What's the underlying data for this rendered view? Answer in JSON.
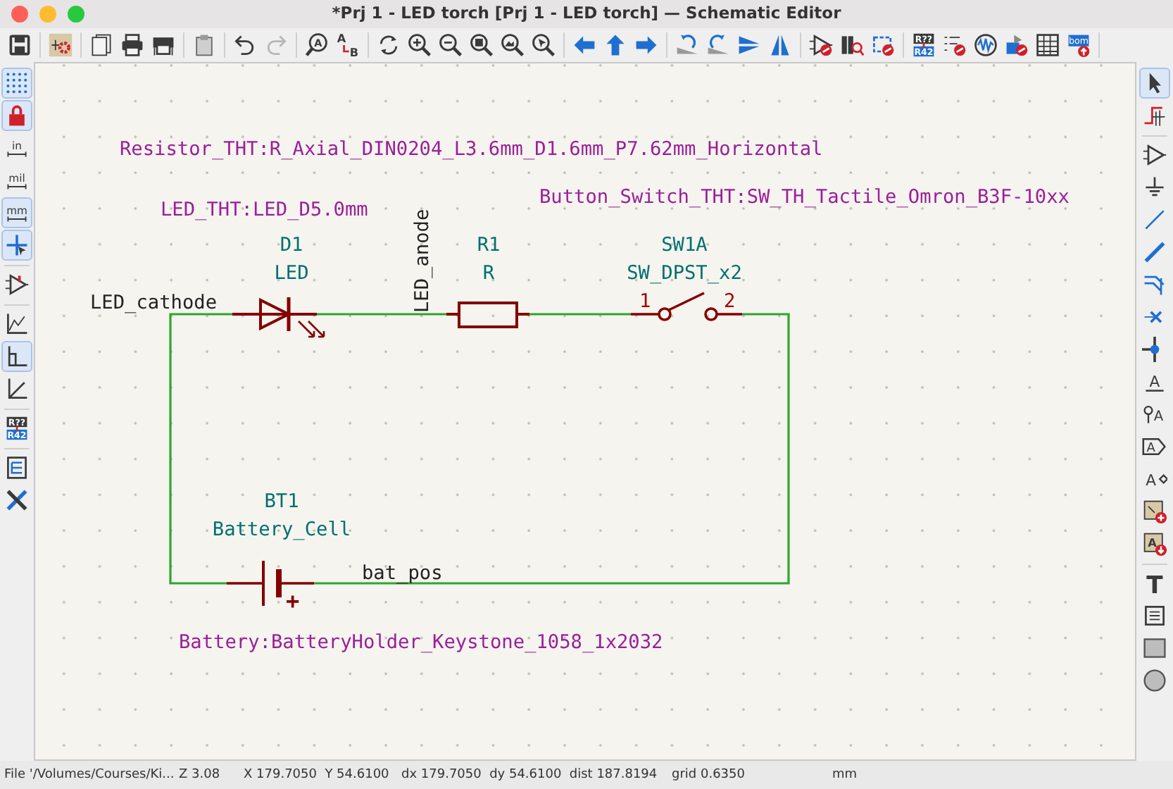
{
  "window": {
    "title": "*Prj 1 - LED torch [Prj 1 - LED torch] — Schematic Editor"
  },
  "top_toolbar": [
    {
      "kind": "save",
      "disabled": false
    },
    {
      "kind": "separator"
    },
    {
      "kind": "schematic-setup",
      "disabled": false
    },
    {
      "kind": "separator"
    },
    {
      "kind": "page-settings",
      "disabled": false
    },
    {
      "kind": "print",
      "disabled": false
    },
    {
      "kind": "plot",
      "disabled": false
    },
    {
      "kind": "separator"
    },
    {
      "kind": "paste",
      "disabled": false
    },
    {
      "kind": "separator"
    },
    {
      "kind": "undo",
      "disabled": false
    },
    {
      "kind": "redo",
      "disabled": true
    },
    {
      "kind": "separator"
    },
    {
      "kind": "find",
      "disabled": false,
      "labels": [
        "A"
      ]
    },
    {
      "kind": "find-replace",
      "disabled": false,
      "labels": [
        "A",
        "B"
      ]
    },
    {
      "kind": "separator"
    },
    {
      "kind": "refresh",
      "disabled": false
    },
    {
      "kind": "zoom-in",
      "disabled": false
    },
    {
      "kind": "zoom-out",
      "disabled": false
    },
    {
      "kind": "zoom-fit",
      "disabled": false
    },
    {
      "kind": "zoom-objects",
      "disabled": false
    },
    {
      "kind": "zoom-selection",
      "disabled": false
    },
    {
      "kind": "separator"
    },
    {
      "kind": "nav-left",
      "disabled": false
    },
    {
      "kind": "nav-up",
      "disabled": false
    },
    {
      "kind": "nav-right",
      "disabled": false
    },
    {
      "kind": "separator"
    },
    {
      "kind": "rotate-ccw",
      "disabled": false
    },
    {
      "kind": "rotate-cw",
      "disabled": false
    },
    {
      "kind": "mirror-vertical",
      "disabled": false
    },
    {
      "kind": "mirror-horizontal",
      "disabled": false
    },
    {
      "kind": "separator"
    },
    {
      "kind": "symbol-editor",
      "disabled": false
    },
    {
      "kind": "library-browser",
      "disabled": false
    },
    {
      "kind": "footprint-editor",
      "disabled": false
    },
    {
      "kind": "separator"
    },
    {
      "kind": "annotate",
      "disabled": false,
      "labels": [
        "R??",
        "R42"
      ]
    },
    {
      "kind": "erc",
      "disabled": false
    },
    {
      "kind": "simulator",
      "disabled": false
    },
    {
      "kind": "pcb-editor",
      "disabled": false
    },
    {
      "kind": "fields-table",
      "disabled": false
    },
    {
      "kind": "bom",
      "disabled": false,
      "labels": [
        "bom"
      ]
    },
    {
      "kind": "separator"
    }
  ],
  "left_toolbar": [
    {
      "kind": "grid-dots",
      "selected": true
    },
    {
      "kind": "padlock",
      "selected": true
    },
    {
      "kind": "units",
      "selected": false,
      "labels": [
        "in"
      ]
    },
    {
      "kind": "units",
      "selected": false,
      "labels": [
        "mil"
      ]
    },
    {
      "kind": "units",
      "selected": true,
      "labels": [
        "mm"
      ]
    },
    {
      "kind": "crosshair",
      "selected": true
    },
    {
      "kind": "separator"
    },
    {
      "kind": "hidden-pins",
      "selected": false
    },
    {
      "kind": "separator"
    },
    {
      "kind": "line-free",
      "selected": false
    },
    {
      "kind": "line-90",
      "selected": true
    },
    {
      "kind": "line-45",
      "selected": false
    },
    {
      "kind": "separator"
    },
    {
      "kind": "annotate",
      "selected": false,
      "labels": [
        "R??",
        "R42"
      ]
    },
    {
      "kind": "separator"
    },
    {
      "kind": "hierarchy",
      "selected": false
    },
    {
      "kind": "tools",
      "selected": false
    }
  ],
  "right_toolbar": [
    {
      "kind": "select",
      "selected": true
    },
    {
      "kind": "ratsnest",
      "selected": false
    },
    {
      "kind": "separator"
    },
    {
      "kind": "symbol",
      "selected": false
    },
    {
      "kind": "power",
      "selected": false
    },
    {
      "kind": "wire",
      "selected": false
    },
    {
      "kind": "bus",
      "selected": false
    },
    {
      "kind": "bus-entry",
      "selected": false
    },
    {
      "kind": "no-connect",
      "selected": false
    },
    {
      "kind": "junction",
      "selected": false
    },
    {
      "kind": "net-label",
      "selected": false,
      "labels": [
        "A"
      ]
    },
    {
      "kind": "netclass",
      "selected": false,
      "labels": [
        "A"
      ]
    },
    {
      "kind": "global-label",
      "selected": false,
      "labels": [
        "A"
      ]
    },
    {
      "kind": "hier-label",
      "selected": false,
      "labels": [
        "A"
      ]
    },
    {
      "kind": "sheet-import",
      "selected": false
    },
    {
      "kind": "sheet-pin",
      "selected": false,
      "labels": [
        "A"
      ]
    },
    {
      "kind": "separator"
    },
    {
      "kind": "text",
      "selected": false,
      "labels": [
        "T"
      ]
    },
    {
      "kind": "textbox",
      "selected": false
    },
    {
      "kind": "rectangle",
      "selected": false
    },
    {
      "kind": "circle",
      "selected": false
    }
  ],
  "schematic": {
    "components": [
      {
        "kind": "led",
        "reference": "D1",
        "value": "LED"
      },
      {
        "kind": "resistor",
        "reference": "R1",
        "value": "R"
      },
      {
        "kind": "switch",
        "reference": "SW1A",
        "value": "SW_DPST_x2",
        "pins": [
          "1",
          "2"
        ]
      },
      {
        "kind": "battery",
        "reference": "BT1",
        "value": "Battery_Cell",
        "polarity_mark": "+"
      }
    ],
    "footprint_fields": [
      "Resistor_THT:R_Axial_DIN0204_L3.6mm_D1.6mm_P7.62mm_Horizontal",
      "Button_Switch_THT:SW_TH_Tactile_Omron_B3F-10xx",
      "LED_THT:LED_D5.0mm",
      "Battery:BatteryHolder_Keystone_1058_1x2032"
    ],
    "net_labels": [
      "LED_cathode",
      "LED_anode",
      "bat_pos"
    ]
  },
  "status_bar": [
    "File '/Volumes/Courses/Ki...",
    "Z 3.08",
    "X 179.7050  Y 54.6100",
    "dx 179.7050  dy 54.6100  dist 187.8194",
    "grid 0.6350",
    "mm"
  ]
}
